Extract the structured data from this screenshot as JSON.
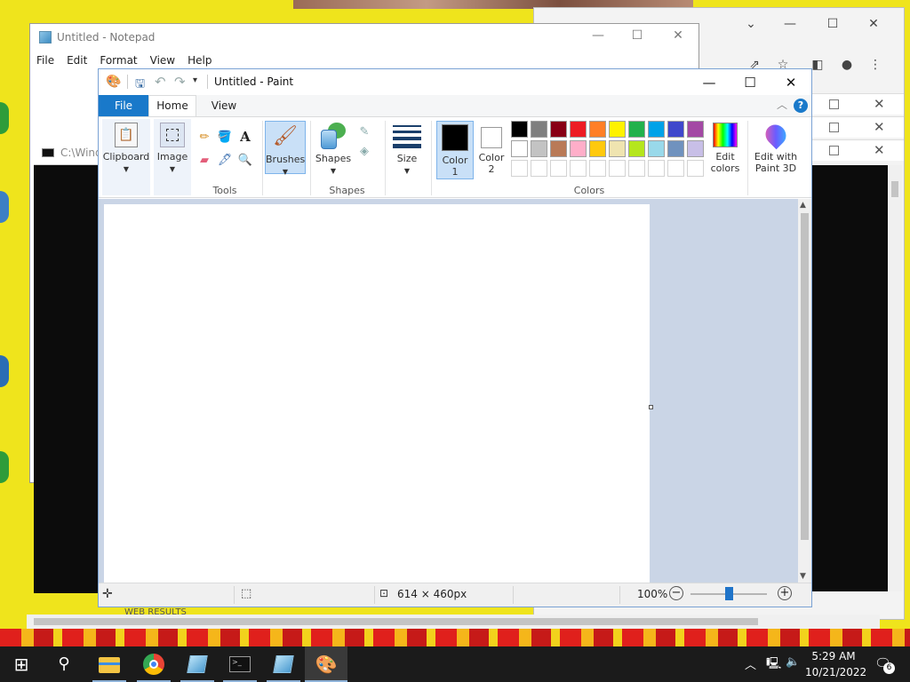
{
  "notepad": {
    "title": "Untitled - Notepad",
    "menu": [
      "File",
      "Edit",
      "Format",
      "View",
      "Help"
    ]
  },
  "cmd": {
    "title": "C:\\Windows"
  },
  "chrome": {
    "web_results": "WEB RESULTS"
  },
  "paint": {
    "title": "Untitled - Paint",
    "tabs": {
      "file": "File",
      "home": "Home",
      "view": "View"
    },
    "ribbon": {
      "clipboard": "Clipboard",
      "image": "Image",
      "tools_label": "Tools",
      "brushes": "Brushes",
      "shapes": "Shapes",
      "shapes_label": "Shapes",
      "size": "Size",
      "color1_line1": "Color",
      "color1_line2": "1",
      "color2_line1": "Color",
      "color2_line2": "2",
      "colors_label": "Colors",
      "edit_colors_line1": "Edit",
      "edit_colors_line2": "colors",
      "paint3d_line1": "Edit with",
      "paint3d_line2": "Paint 3D"
    },
    "palette_row1": [
      "#000000",
      "#7f7f7f",
      "#880015",
      "#ed1c24",
      "#ff7f27",
      "#fff200",
      "#22b14c",
      "#00a2e8",
      "#3f48cc",
      "#a349a4"
    ],
    "palette_row2": [
      "#ffffff",
      "#c3c3c3",
      "#b97a57",
      "#ffaec9",
      "#ffc90e",
      "#efe4b0",
      "#b5e61d",
      "#99d9ea",
      "#7092be",
      "#c8bfe7"
    ],
    "status": {
      "dimensions": "614 × 460px",
      "zoom": "100%"
    }
  },
  "taskbar": {
    "time": "5:29 AM",
    "date": "10/21/2022",
    "notification_count": "6"
  }
}
